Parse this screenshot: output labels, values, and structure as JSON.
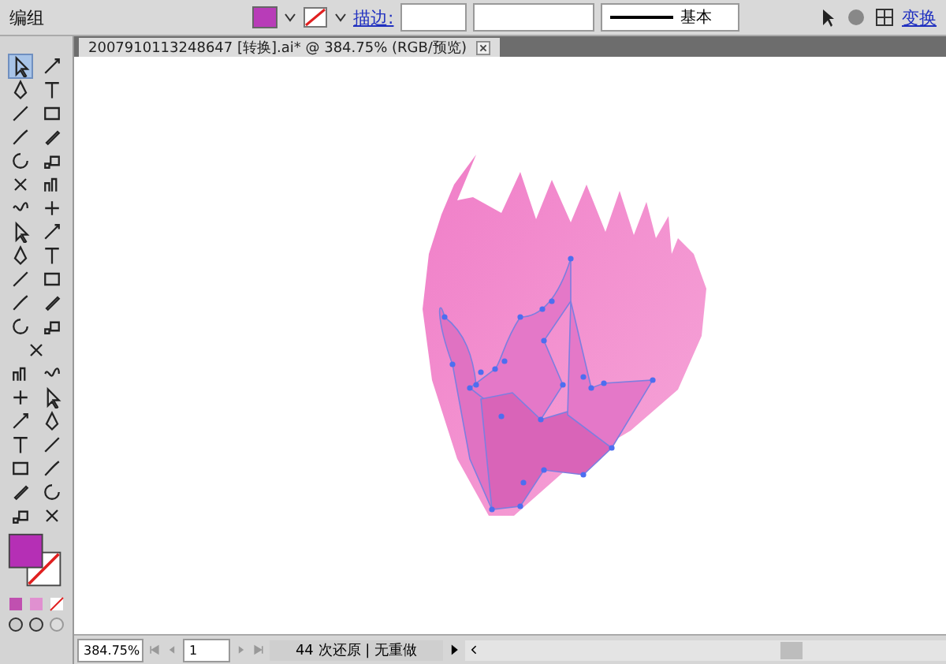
{
  "control_bar": {
    "selection_label": "编组",
    "stroke_link": "描边:",
    "stroke_profile": "基本",
    "transform_link": "变换"
  },
  "document_tab": {
    "title": "2007910113248647  [转换].ai* @ 384.75% (RGB/预览)"
  },
  "tools": [
    {
      "selected": true
    },
    {
      "selected": false
    },
    {
      "selected": false
    },
    {
      "selected": false
    },
    {
      "selected": false
    },
    {
      "selected": false
    },
    {
      "selected": false
    },
    {
      "selected": false
    },
    {
      "selected": false
    },
    {
      "selected": false
    },
    {
      "selected": false
    },
    {
      "selected": false
    },
    {
      "selected": false
    },
    {
      "selected": false
    },
    {
      "selected": false
    },
    {
      "selected": false
    },
    {
      "selected": false
    },
    {
      "selected": false
    },
    {
      "selected": false
    },
    {
      "selected": false
    },
    {
      "selected": false
    },
    {
      "selected": false
    },
    {
      "selected": false
    },
    {
      "selected": false
    },
    {
      "selected": false
    },
    {
      "selected": false
    },
    {
      "selected": false
    },
    {
      "selected": false
    },
    {
      "selected": false
    },
    {
      "selected": false
    },
    {
      "selected": false
    },
    {
      "selected": false
    },
    {
      "selected": false
    },
    {
      "selected": false
    },
    {
      "selected": false
    },
    {
      "selected": false
    },
    {
      "selected": false
    },
    {
      "selected": false
    },
    {
      "selected": false
    }
  ],
  "status_bar": {
    "zoom": "384.75%",
    "page": "1",
    "history": "44 次还原 | 无重做"
  }
}
